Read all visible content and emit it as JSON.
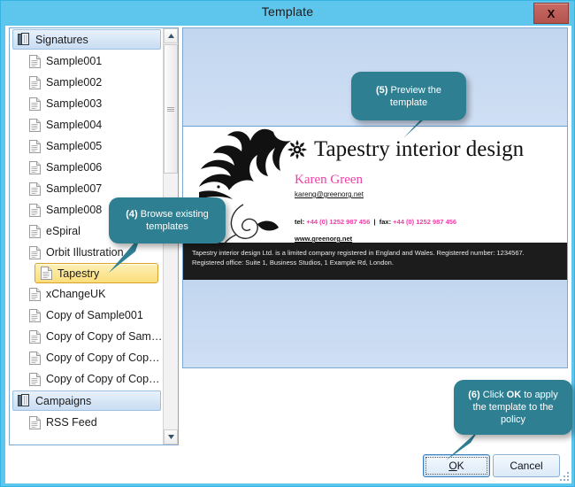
{
  "window": {
    "title": "Template",
    "close_label": "X",
    "close_icon": "close-icon"
  },
  "tree": {
    "items": [
      {
        "label": "Signatures",
        "type": "group",
        "icon": "folder-icon"
      },
      {
        "label": "Sample001",
        "type": "child",
        "icon": "document-icon"
      },
      {
        "label": "Sample002",
        "type": "child",
        "icon": "document-icon"
      },
      {
        "label": "Sample003",
        "type": "child",
        "icon": "document-icon"
      },
      {
        "label": "Sample004",
        "type": "child",
        "icon": "document-icon"
      },
      {
        "label": "Sample005",
        "type": "child",
        "icon": "document-icon"
      },
      {
        "label": "Sample006",
        "type": "child",
        "icon": "document-icon"
      },
      {
        "label": "Sample007",
        "type": "child",
        "icon": "document-icon"
      },
      {
        "label": "Sample008",
        "type": "child",
        "icon": "document-icon"
      },
      {
        "label": "eSpiral",
        "type": "child",
        "icon": "document-icon"
      },
      {
        "label": "Orbit Illustration",
        "type": "child",
        "icon": "document-icon"
      },
      {
        "label": "Tapestry",
        "type": "selected",
        "icon": "document-icon"
      },
      {
        "label": "xChangeUK",
        "type": "child",
        "icon": "document-icon"
      },
      {
        "label": "Copy of Sample001",
        "type": "child",
        "icon": "document-icon"
      },
      {
        "label": "Copy of Copy of Sample0...",
        "type": "child",
        "icon": "document-icon"
      },
      {
        "label": "Copy of Copy of Copy of...",
        "type": "child",
        "icon": "document-icon"
      },
      {
        "label": "Copy of Copy of Copy of...",
        "type": "child",
        "icon": "document-icon"
      },
      {
        "label": "Campaigns",
        "type": "group",
        "icon": "folder-icon"
      },
      {
        "label": "RSS Feed",
        "type": "child",
        "icon": "document-icon"
      }
    ],
    "scrollbar": {
      "up_arrow": "▲",
      "down_arrow": "▼"
    }
  },
  "preview": {
    "brand_name": "Tapestry interior design",
    "person_name": "Karen Green",
    "email": "kareng@greenorg.net",
    "tel_label": "tel:",
    "tel_value": "+44 (0) 1252 987 456",
    "separator": "|",
    "fax_label": "fax:",
    "fax_value": "+44 (0) 1252 987 456",
    "website": "www.greenorg.net",
    "disclaimer": "Tapestry interior design Ltd. is a limited company registered in England and Wales. Registered number: 1234567. Registered office: Suite 1, Business Studios, 1 Example Rd, London."
  },
  "callouts": [
    {
      "step": "(5)",
      "text": " Preview the template"
    },
    {
      "step": "(4)",
      "text": " Browse existing templates"
    },
    {
      "step": "(6)",
      "text": " Click ",
      "bold": "OK",
      "text2": " to apply the template to the policy"
    }
  ],
  "footer": {
    "ok_label": "OK",
    "ok_accel": "O",
    "ok_rest": "K",
    "cancel_label": "Cancel"
  },
  "colors": {
    "window_frame": "#5ec5ec",
    "callout": "#2f7f92",
    "accent_pink": "#ef3fa6",
    "selection": "#fbdd7a",
    "close_button": "#b4544e",
    "panel_band": "#c2d6ef"
  }
}
